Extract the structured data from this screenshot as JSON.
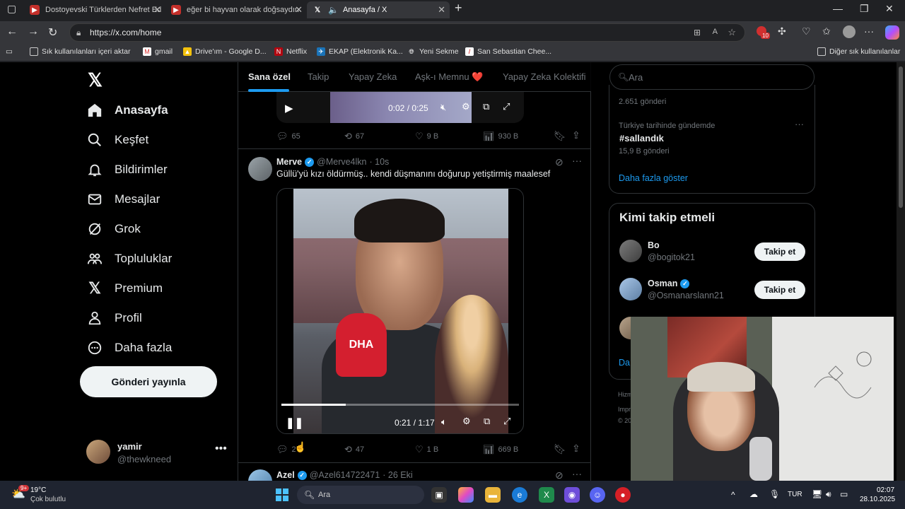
{
  "browser": {
    "tabs": [
      {
        "title": "Dostoyevski Türklerden Nefret Ed"
      },
      {
        "title": "eğer bi hayvan olarak doğsaydın"
      },
      {
        "title": "Anasayfa / X"
      }
    ],
    "url": "https://x.com/home",
    "bookmarks": [
      "Sık kullanılanları içeri aktar",
      "gmail",
      "Drive'ım - Google D...",
      "Netflix",
      "EKAP (Elektronik Ka...",
      "Yeni Sekme",
      "San Sebastian Chee..."
    ],
    "other_bookmarks": "Diğer sık kullanılanlar",
    "ext_badge": "10"
  },
  "nav": {
    "items": [
      {
        "label": "Anasayfa",
        "icon": "home-icon"
      },
      {
        "label": "Keşfet",
        "icon": "search-icon"
      },
      {
        "label": "Bildirimler",
        "icon": "bell-icon"
      },
      {
        "label": "Mesajlar",
        "icon": "mail-icon"
      },
      {
        "label": "Grok",
        "icon": "grok-icon"
      },
      {
        "label": "Topluluklar",
        "icon": "communities-icon"
      },
      {
        "label": "Premium",
        "icon": "x-premium-icon"
      },
      {
        "label": "Profil",
        "icon": "profile-icon"
      },
      {
        "label": "Daha fazla",
        "icon": "more-circle-icon"
      }
    ],
    "post_button": "Gönderi yayınla",
    "profile_name": "yamir",
    "profile_handle": "@thewkneed"
  },
  "feed": {
    "tabs": [
      "Sana özel",
      "Takip",
      "Yapay Zeka",
      "Aşk-ı Memnu ❤️",
      "Yapay Zeka Kolektifi"
    ],
    "prev_post": {
      "video_time": "0:02 / 0:25",
      "replies": "65",
      "reposts": "67",
      "likes": "9 B",
      "views": "930 B"
    },
    "post": {
      "name": "Merve",
      "handle": "@Merve4lkn",
      "time": "· 10s",
      "text": "Güllü'yü kızı öldürmüş.. kendi düşmanını doğurup yetiştirmiş maalesef",
      "mic_text": "DHA",
      "video_time": "0:21 / 1:17",
      "video_progress": 0.27,
      "replies": "2",
      "reposts": "47",
      "likes": "1 B",
      "views": "669 B"
    },
    "next_post": {
      "name": "Azel",
      "handle": "@Azel614722471",
      "time": "· 26 Eki"
    }
  },
  "sidebar": {
    "search_placeholder": "Ara",
    "trend_count_top": "2.651 gönderi",
    "trend_context": "Türkiye tarihinde gündemde",
    "trend_name": "#sallandık",
    "trend_count": "15,9 B gönderi",
    "show_more": "Daha fazla göster",
    "follow_title": "Kimi takip etmeli",
    "follow": [
      {
        "name": "Bo",
        "handle": "@bogitok21",
        "button": "Takip et"
      },
      {
        "name": "Osman",
        "handle": "@Osmanarslann21",
        "button": "Takip et"
      }
    ],
    "show_more_partial": "Da",
    "footer_partial": [
      "Hizm",
      "Impri",
      "© 20"
    ]
  },
  "taskbar": {
    "weather_badge": "9+",
    "temp": "19°C",
    "weather": "Çok bulutlu",
    "search": "Ara",
    "lang": "TUR",
    "time": "02:07",
    "date": "28.10.2025"
  },
  "colors": {
    "accent": "#1d9bf0",
    "background": "#000000",
    "text": "#e7e9ea",
    "muted": "#71767b"
  }
}
